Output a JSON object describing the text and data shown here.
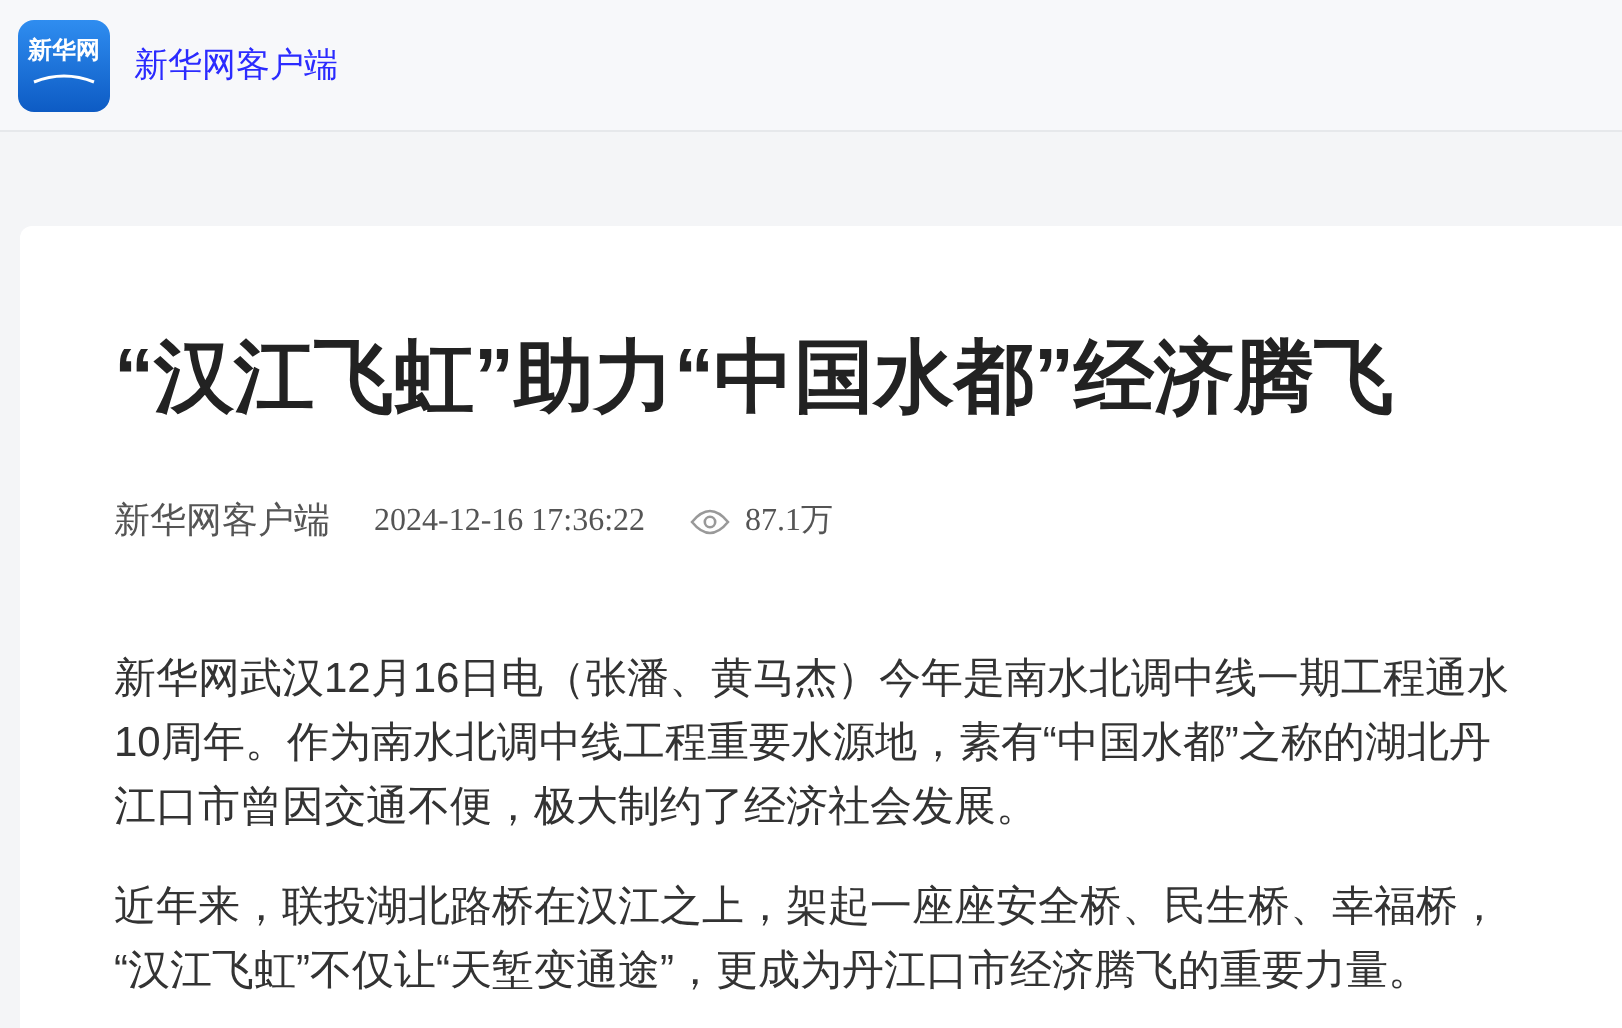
{
  "header": {
    "logo_text": "新华网",
    "site_name": "新华网客户端"
  },
  "article": {
    "title": "“汉江飞虹”助力“中国水都”经济腾飞",
    "source": "新华网客户端",
    "datetime": "2024-12-16 17:36:22",
    "views": "87.1万",
    "paragraphs": [
      [
        "新华网武汉12月16日电（张潘、黄马杰）今年是南水北调中线一期工程通水",
        "10周年。作为南水北调中线工程重要水源地，素有“中国水都”之称的湖北丹",
        "江口市曾因交通不便，极大制约了经济社会发展。"
      ],
      [
        "近年来，联投湖北路桥在汉江之上，架起一座座安全桥、民生桥、幸福桥，",
        "“汉江飞虹”不仅让“天堑变通途”，更成为丹江口市经济腾飞的重要力量。"
      ]
    ]
  }
}
